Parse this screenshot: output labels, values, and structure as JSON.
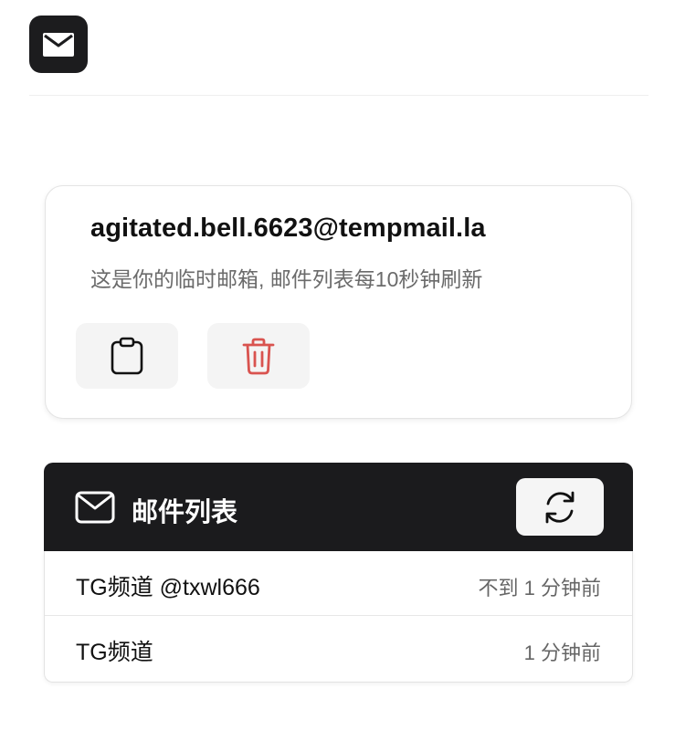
{
  "header": {
    "logo_icon": "envelope-icon"
  },
  "address_card": {
    "email": "agitated.bell.6623@tempmail.la",
    "description": "这是你的临时邮箱, 邮件列表每10秒钟刷新",
    "copy_icon": "clipboard-icon",
    "delete_icon": "trash-icon",
    "delete_color": "#d9534f"
  },
  "mail_panel": {
    "title": "邮件列表",
    "title_icon": "mail-icon",
    "refresh_icon": "refresh-icon",
    "messages": [
      {
        "subject": "TG频道 @txwl666",
        "time": "不到 1 分钟前"
      },
      {
        "subject": "TG频道",
        "time": "1 分钟前"
      }
    ]
  }
}
